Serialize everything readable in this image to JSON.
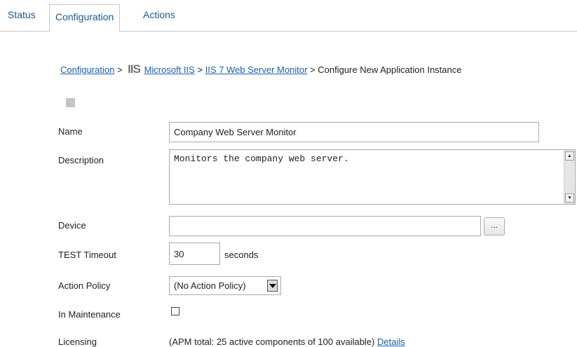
{
  "tabs": [
    {
      "label": "Status"
    },
    {
      "label": "Configuration",
      "active": true
    },
    {
      "label": "Actions"
    }
  ],
  "breadcrumb": {
    "configuration": "Configuration",
    "sep": ">",
    "iis_logo": "IIS",
    "microsoft_iis": "Microsoft IIS",
    "iis7": "IIS 7 Web Server Monitor",
    "current": "Configure New Application Instance"
  },
  "form": {
    "name_label": "Name",
    "name_value": "Company Web Server Monitor",
    "description_label": "Description",
    "description_value": "Monitors the company web server.",
    "device_label": "Device",
    "device_value": "",
    "browse_label": "...",
    "timeout_label": "TEST Timeout",
    "timeout_value": "30",
    "timeout_unit": "seconds",
    "action_policy_label": "Action Policy",
    "action_policy_value": "(No Action Policy)",
    "maintenance_label": "In Maintenance",
    "maintenance_checked": false,
    "licensing_label": "Licensing",
    "licensing_text": "(APM total: 25 active components of 100 available)",
    "details_link": "Details"
  },
  "colors": {
    "link": "#1a5fb4",
    "tab_text": "#1a5a96"
  }
}
